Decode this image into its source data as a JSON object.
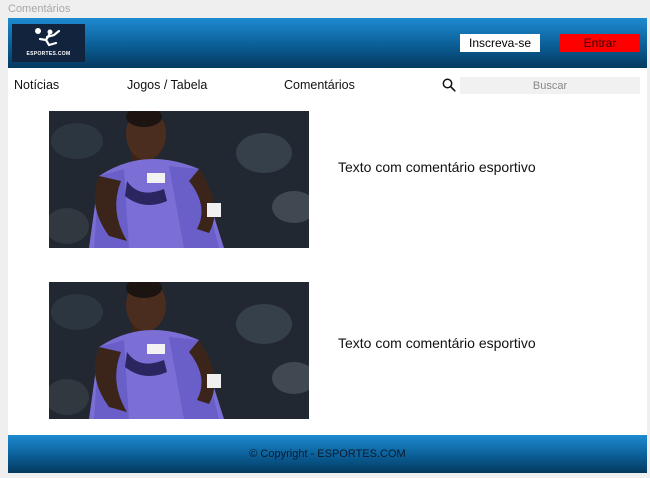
{
  "frame": {
    "label": "Comentários"
  },
  "header": {
    "logo_text": "ESPORTES.COM",
    "signup_label": "Inscreva-se",
    "login_label": "Entrar"
  },
  "nav": {
    "items": [
      {
        "label": "Notícias"
      },
      {
        "label": "Jogos / Tabela"
      },
      {
        "label": "Comentários"
      }
    ],
    "search_icon": "search-icon",
    "search_placeholder": "Buscar"
  },
  "posts": [
    {
      "text": "Texto com comentário esportivo"
    },
    {
      "text": "Texto com comentário esportivo"
    }
  ],
  "footer": {
    "copyright": "© Copyright - ESPORTES.COM"
  },
  "colors": {
    "header_top": "#1d8ad0",
    "header_bottom": "#04395f",
    "login_button": "#ff0000",
    "logo_bg": "#12233d",
    "jersey": "#7b6fd6"
  }
}
